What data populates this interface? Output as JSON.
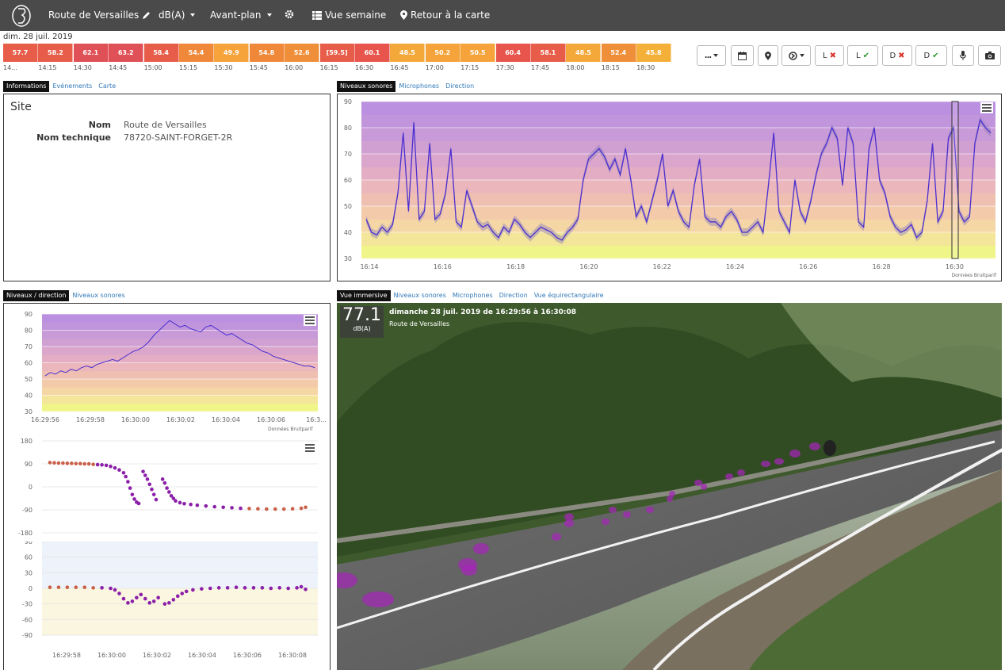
{
  "nav": {
    "site": "Route de Versailles",
    "unit": "dB(A)",
    "layer": "Avant-plan",
    "week": "Vue semaine",
    "back": "Retour à la carte"
  },
  "date": "dim. 28 juil. 2019",
  "timeline": {
    "cells": [
      {
        "v": "57.7",
        "c": "#e85d4a"
      },
      {
        "v": "58.2",
        "c": "#e85d4a"
      },
      {
        "v": "62.1",
        "c": "#e05157"
      },
      {
        "v": "63.2",
        "c": "#e05157"
      },
      {
        "v": "58.4",
        "c": "#e85d4a"
      },
      {
        "v": "54.4",
        "c": "#f0883a"
      },
      {
        "v": "49.9",
        "c": "#f5a33a"
      },
      {
        "v": "54.8",
        "c": "#f0883a"
      },
      {
        "v": "52.6",
        "c": "#f08f3a"
      },
      {
        "v": "[59.5]",
        "c": "#e85d4a"
      },
      {
        "v": "60.1",
        "c": "#e8554d"
      },
      {
        "v": "48.5",
        "c": "#f5a83a"
      },
      {
        "v": "50.2",
        "c": "#f5a33a"
      },
      {
        "v": "50.5",
        "c": "#f5a33a"
      },
      {
        "v": "60.4",
        "c": "#e8554d"
      },
      {
        "v": "58.1",
        "c": "#e85d4a"
      },
      {
        "v": "48.5",
        "c": "#f5a83a"
      },
      {
        "v": "52.4",
        "c": "#f08f3a"
      },
      {
        "v": "45.8",
        "c": "#f5b03a"
      }
    ],
    "times": [
      "14...",
      "14:15",
      "14:30",
      "14:45",
      "15:00",
      "15:15",
      "15:30",
      "15:45",
      "16:00",
      "16:15",
      "16:30",
      "16:45",
      "17:00",
      "17:15",
      "17:30",
      "17:45",
      "18:00",
      "18:15",
      "18:30"
    ]
  },
  "toolbar": {
    "more": "...",
    "l_off": "L",
    "l_on": "L",
    "d_off": "D",
    "d_on": "D"
  },
  "info_tabs": [
    "Informations",
    "Evénements",
    "Carte"
  ],
  "info": {
    "title": "Site",
    "rows": [
      {
        "k": "Nom",
        "v": "Route de Versailles"
      },
      {
        "k": "Nom technique",
        "v": "78720-SAINT-FORGET-2R"
      }
    ]
  },
  "sound_tabs": [
    "Niveaux sonores",
    "Microphones",
    "Direction"
  ],
  "dir_tabs": [
    "Niveaux / direction",
    "Niveaux sonores"
  ],
  "imm_tabs": [
    "Vue immersive",
    "Niveaux sonores",
    "Microphones",
    "Direction",
    "Vue équirectangulaire"
  ],
  "credits": "Données Bruitparif",
  "immersive": {
    "level": "77.1",
    "unit": "dB(A)",
    "title": "dimanche 28 juil. 2019 de 16:29:56 à 16:30:08",
    "subtitle": "Route de Versailles"
  },
  "colors": {
    "line": "#4b2fd0",
    "scatter": "#8b1fa9",
    "nav": "#4a4a4a"
  },
  "chart_data": [
    {
      "type": "line",
      "name": "sound-levels",
      "x_labels": [
        "16:14",
        "16:16",
        "16:18",
        "16:20",
        "16:22",
        "16:24",
        "16:26",
        "16:28",
        "16:30"
      ],
      "ylim": [
        30,
        90
      ],
      "y_ticks": [
        "30",
        "40",
        "50",
        "60",
        "70",
        "80",
        "90"
      ],
      "x_range_minutes": [
        16.0,
        17.6
      ],
      "values": [
        45,
        40,
        39,
        42,
        40,
        43,
        55,
        78,
        48,
        82,
        45,
        48,
        74,
        45,
        47,
        55,
        72,
        44,
        42,
        56,
        50,
        44,
        42,
        43,
        40,
        38,
        42,
        40,
        45,
        43,
        40,
        38,
        40,
        42,
        41,
        40,
        38,
        37,
        40,
        42,
        45,
        60,
        68,
        70,
        72,
        69,
        64,
        68,
        62,
        72,
        60,
        46,
        50,
        44,
        52,
        60,
        70,
        50,
        56,
        48,
        44,
        42,
        58,
        68,
        46,
        44,
        44,
        42,
        46,
        48,
        45,
        40,
        40,
        42,
        44,
        40,
        58,
        78,
        48,
        44,
        40,
        60,
        48,
        44,
        52,
        62,
        70,
        74,
        80,
        76,
        58,
        80,
        74,
        44,
        42,
        72,
        80,
        60,
        55,
        46,
        42,
        40,
        41,
        43,
        38,
        40,
        52,
        74,
        44,
        48,
        76,
        80,
        48,
        44,
        46,
        74,
        83,
        80,
        78
      ],
      "highlight_minutes": [
        16.495,
        16.515
      ]
    },
    {
      "type": "line",
      "name": "levels-direction-levels",
      "x_labels": [
        "16:29:56",
        "16:29:58",
        "16:30:00",
        "16:30:02",
        "16:30:04",
        "16:30:06",
        "16:3..."
      ],
      "ylim": [
        30,
        90
      ],
      "y_ticks": [
        "30",
        "40",
        "50",
        "60",
        "70",
        "80",
        "90"
      ],
      "values": [
        52,
        54,
        53,
        55,
        54,
        56,
        55,
        57,
        58,
        57,
        59,
        60,
        61,
        62,
        61,
        63,
        65,
        67,
        68,
        70,
        73,
        77,
        80,
        83,
        86,
        84,
        82,
        83,
        81,
        80,
        79,
        82,
        83,
        81,
        79,
        77,
        78,
        76,
        74,
        72,
        71,
        69,
        67,
        66,
        64,
        63,
        62,
        61,
        60,
        59,
        58,
        58,
        57
      ]
    },
    {
      "type": "scatter",
      "name": "direction-azimuth",
      "ylim": [
        -180,
        180
      ],
      "y_ticks": [
        "180",
        "90",
        "0",
        "-90",
        "-180"
      ],
      "points": [
        [
          0,
          95
        ],
        [
          2,
          94
        ],
        [
          4,
          93
        ],
        [
          6,
          93
        ],
        [
          8,
          92
        ],
        [
          10,
          92
        ],
        [
          12,
          91
        ],
        [
          14,
          91
        ],
        [
          16,
          90
        ],
        [
          18,
          90
        ],
        [
          20,
          88
        ],
        [
          22,
          87
        ],
        [
          24,
          86
        ],
        [
          26,
          84
        ],
        [
          28,
          80
        ],
        [
          30,
          74
        ],
        [
          32,
          66
        ],
        [
          34,
          55
        ],
        [
          35,
          40
        ],
        [
          36,
          20
        ],
        [
          37,
          -5
        ],
        [
          38,
          -30
        ],
        [
          39,
          -48
        ],
        [
          40,
          -60
        ],
        [
          41,
          -65
        ],
        [
          43,
          60
        ],
        [
          44,
          45
        ],
        [
          45,
          30
        ],
        [
          46,
          10
        ],
        [
          47,
          -10
        ],
        [
          48,
          -30
        ],
        [
          49,
          -50
        ],
        [
          52,
          30
        ],
        [
          53,
          15
        ],
        [
          54,
          -5
        ],
        [
          55,
          -20
        ],
        [
          56,
          -35
        ],
        [
          57,
          -45
        ],
        [
          58,
          -55
        ],
        [
          60,
          -62
        ],
        [
          62,
          -66
        ],
        [
          65,
          -69
        ],
        [
          68,
          -72
        ],
        [
          72,
          -75
        ],
        [
          76,
          -78
        ],
        [
          80,
          -80
        ],
        [
          84,
          -82
        ],
        [
          88,
          -84
        ],
        [
          92,
          -85
        ],
        [
          96,
          -86
        ],
        [
          100,
          -87
        ],
        [
          104,
          -87
        ],
        [
          108,
          -87
        ],
        [
          112,
          -86
        ],
        [
          116,
          -84
        ],
        [
          118,
          -80
        ]
      ]
    },
    {
      "type": "scatter",
      "name": "direction-elevation",
      "ylim": [
        -90,
        90
      ],
      "y_ticks": [
        "90",
        "60",
        "30",
        "0",
        "-30",
        "-60",
        "-90"
      ],
      "x_labels": [
        "16:29:58",
        "16:30:00",
        "16:30:02",
        "16:30:04",
        "16:30:06",
        "16:30:08"
      ],
      "points": [
        [
          0,
          2
        ],
        [
          4,
          2
        ],
        [
          8,
          2
        ],
        [
          12,
          2
        ],
        [
          16,
          2
        ],
        [
          20,
          1
        ],
        [
          24,
          1
        ],
        [
          28,
          0
        ],
        [
          30,
          -3
        ],
        [
          32,
          -10
        ],
        [
          34,
          -20
        ],
        [
          36,
          -28
        ],
        [
          38,
          -25
        ],
        [
          40,
          -18
        ],
        [
          42,
          -12
        ],
        [
          44,
          -20
        ],
        [
          46,
          -28
        ],
        [
          48,
          -25
        ],
        [
          50,
          -18
        ],
        [
          53,
          -30
        ],
        [
          55,
          -28
        ],
        [
          57,
          -22
        ],
        [
          59,
          -15
        ],
        [
          61,
          -10
        ],
        [
          63,
          -6
        ],
        [
          66,
          -3
        ],
        [
          70,
          -1
        ],
        [
          74,
          0
        ],
        [
          78,
          1
        ],
        [
          82,
          1
        ],
        [
          86,
          2
        ],
        [
          90,
          1
        ],
        [
          94,
          1
        ],
        [
          98,
          1
        ],
        [
          102,
          0
        ],
        [
          106,
          1
        ],
        [
          110,
          0
        ],
        [
          114,
          1
        ],
        [
          116,
          3
        ],
        [
          118,
          -2
        ]
      ]
    }
  ],
  "immersive_points": [
    {
      "x": 8,
      "y": 350,
      "rx": 18,
      "ry": 10
    },
    {
      "x": 52,
      "y": 374,
      "rx": 20,
      "ry": 10
    },
    {
      "x": 165,
      "y": 330,
      "rx": 12,
      "ry": 8
    },
    {
      "x": 182,
      "y": 310,
      "rx": 10,
      "ry": 7
    },
    {
      "x": 167,
      "y": 337,
      "rx": 10,
      "ry": 7
    },
    {
      "x": 277,
      "y": 295,
      "rx": 6,
      "ry": 5
    },
    {
      "x": 293,
      "y": 278,
      "rx": 6,
      "ry": 5
    },
    {
      "x": 293,
      "y": 270,
      "rx": 6,
      "ry": 5
    },
    {
      "x": 339,
      "y": 276,
      "rx": 5,
      "ry": 4
    },
    {
      "x": 348,
      "y": 261,
      "rx": 5,
      "ry": 4
    },
    {
      "x": 366,
      "y": 267,
      "rx": 5,
      "ry": 4
    },
    {
      "x": 395,
      "y": 261,
      "rx": 5,
      "ry": 4
    },
    {
      "x": 420,
      "y": 247,
      "rx": 4,
      "ry": 4
    },
    {
      "x": 423,
      "y": 241,
      "rx": 4,
      "ry": 4
    },
    {
      "x": 456,
      "y": 227,
      "rx": 5,
      "ry": 4
    },
    {
      "x": 463,
      "y": 232,
      "rx": 4,
      "ry": 4
    },
    {
      "x": 495,
      "y": 219,
      "rx": 5,
      "ry": 4
    },
    {
      "x": 510,
      "y": 214,
      "rx": 5,
      "ry": 4
    },
    {
      "x": 541,
      "y": 203,
      "rx": 6,
      "ry": 4
    },
    {
      "x": 558,
      "y": 200,
      "rx": 6,
      "ry": 4
    },
    {
      "x": 578,
      "y": 190,
      "rx": 7,
      "ry": 5
    },
    {
      "x": 603,
      "y": 181,
      "rx": 7,
      "ry": 5
    }
  ]
}
